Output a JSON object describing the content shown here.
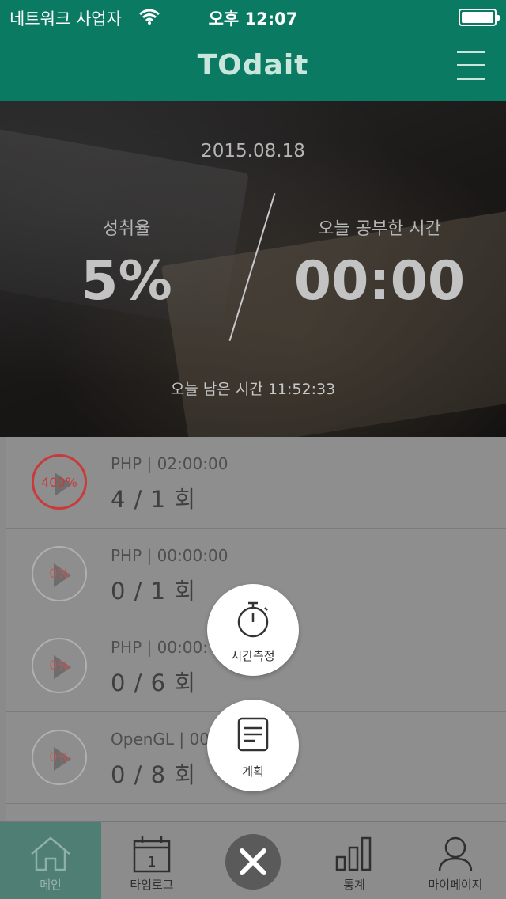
{
  "status_bar": {
    "carrier": "네트워크 사업자",
    "time": "오후 12:07"
  },
  "header": {
    "logo": "TOdait"
  },
  "hero": {
    "date": "2015.08.18",
    "achievement_label": "성취율",
    "achievement_value": "5%",
    "study_time_label": "오늘 공부한 시간",
    "study_time_value": "00:00",
    "remaining": "오늘 남은 시간 11:52:33"
  },
  "tasks": [
    {
      "meta": "PHP | 02:00:00",
      "count": "4 / 1 회",
      "percent": "400%",
      "progress": 4.0
    },
    {
      "meta": "PHP | 00:00:00",
      "count": "0 / 1 회",
      "percent": "0%",
      "progress": 0
    },
    {
      "meta": "PHP | 00:00:",
      "count": "0 / 6 회",
      "percent": "0%",
      "progress": 0
    },
    {
      "meta": "OpenGL | 00",
      "count": "0 / 8 회",
      "percent": "0%",
      "progress": 0
    }
  ],
  "actions": {
    "timer_label": "시간측정",
    "plan_label": "계획"
  },
  "tabbar": {
    "main": "메인",
    "timelog": "타임로그",
    "timelog_day": "1",
    "stats": "통계",
    "mypage": "마이페이지"
  },
  "colors": {
    "brand": "#0b7a63",
    "alert": "#c93a3a"
  }
}
